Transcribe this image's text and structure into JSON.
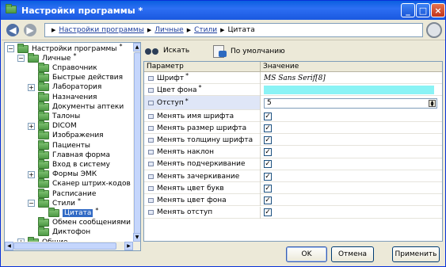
{
  "window": {
    "title": "Настройки программы *"
  },
  "breadcrumb": {
    "items": [
      "Настройки программы",
      "Личные",
      "Стили"
    ],
    "current": "Цитата"
  },
  "tree": {
    "items": [
      {
        "label": "Настройки программы",
        "star": "*",
        "level": 0,
        "exp": "−"
      },
      {
        "label": "Личные",
        "star": "*",
        "level": 1,
        "exp": "−"
      },
      {
        "label": "Справочник",
        "star": "",
        "level": 2,
        "exp": ""
      },
      {
        "label": "Быстрые действия",
        "star": "",
        "level": 2,
        "exp": ""
      },
      {
        "label": "Лаборатория",
        "star": "",
        "level": 2,
        "exp": "+"
      },
      {
        "label": "Назначения",
        "star": "",
        "level": 2,
        "exp": ""
      },
      {
        "label": "Документы аптеки",
        "star": "",
        "level": 2,
        "exp": ""
      },
      {
        "label": "Талоны",
        "star": "",
        "level": 2,
        "exp": ""
      },
      {
        "label": "DICOM",
        "star": "",
        "level": 2,
        "exp": "+"
      },
      {
        "label": "Изображения",
        "star": "",
        "level": 2,
        "exp": ""
      },
      {
        "label": "Пациенты",
        "star": "",
        "level": 2,
        "exp": ""
      },
      {
        "label": "Главная форма",
        "star": "",
        "level": 2,
        "exp": ""
      },
      {
        "label": "Вход в систему",
        "star": "",
        "level": 2,
        "exp": ""
      },
      {
        "label": "Формы ЭМК",
        "star": "",
        "level": 2,
        "exp": "+"
      },
      {
        "label": "Сканер штрих-кодов",
        "star": "",
        "level": 2,
        "exp": ""
      },
      {
        "label": "Расписание",
        "star": "",
        "level": 2,
        "exp": ""
      },
      {
        "label": "Стили",
        "star": "*",
        "level": 2,
        "exp": "−"
      },
      {
        "label": "Цитата",
        "star": "*",
        "level": 3,
        "exp": ""
      },
      {
        "label": "Обмен сообщениями",
        "star": "",
        "level": 2,
        "exp": ""
      },
      {
        "label": "Диктофон",
        "star": "",
        "level": 2,
        "exp": ""
      },
      {
        "label": "Общие",
        "star": "",
        "level": 1,
        "exp": "+"
      }
    ]
  },
  "toolbar": {
    "search_label": "Искать",
    "default_label": "По умолчанию"
  },
  "grid": {
    "col_param": "Параметр",
    "col_value": "Значение",
    "font_row": {
      "name": "Шрифт",
      "star": "*",
      "value": "MS Sans Serif[8]"
    },
    "bg_row": {
      "name": "Цвет фона",
      "star": "*",
      "color": "#8af3f5"
    },
    "indent_row": {
      "name": "Отступ",
      "star": "*",
      "value": "5"
    },
    "check_rows": [
      {
        "name": "Менять имя шрифта",
        "checked": true
      },
      {
        "name": "Менять размер шрифта",
        "checked": true
      },
      {
        "name": "Менять толщину шрифта",
        "checked": true
      },
      {
        "name": "Менять наклон",
        "checked": true
      },
      {
        "name": "Менять подчеркивание",
        "checked": true
      },
      {
        "name": "Менять зачеркивание",
        "checked": true
      },
      {
        "name": "Менять цвет букв",
        "checked": true
      },
      {
        "name": "Менять цвет фона",
        "checked": true
      },
      {
        "name": "Менять отступ",
        "checked": true
      }
    ]
  },
  "buttons": {
    "ok": "OK",
    "cancel": "Отмена",
    "apply": "Применить"
  }
}
